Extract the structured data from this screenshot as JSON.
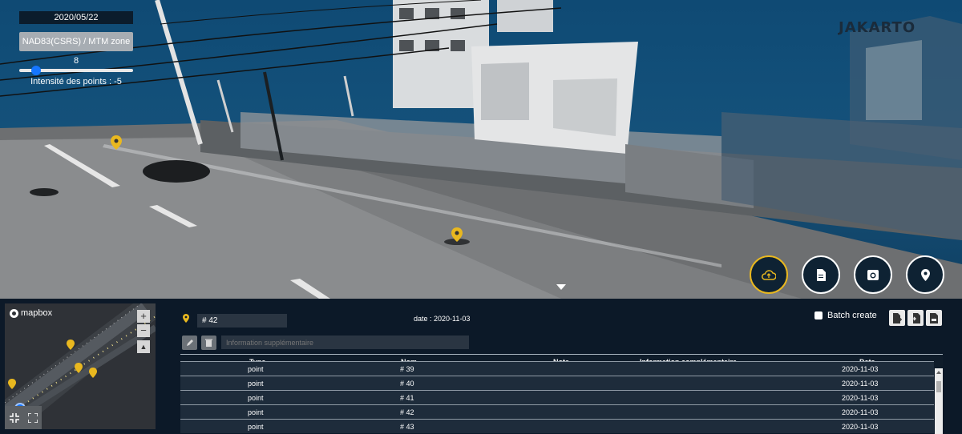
{
  "viewer": {
    "date": "2020/05/22",
    "crs_label": "NAD83(CSRS) / MTM zone 8",
    "intensity_label": "Intensité des points : -5",
    "intensity_value": -5,
    "brand": "JAKARTO"
  },
  "tools": [
    {
      "name": "cloud-upload-icon",
      "active": true
    },
    {
      "name": "document-icon",
      "active": false
    },
    {
      "name": "camera-icon",
      "active": false
    },
    {
      "name": "location-pin-icon",
      "active": false
    }
  ],
  "minimap": {
    "logo": "mapbox",
    "zoom_in": "+",
    "zoom_out": "−"
  },
  "form": {
    "name_value": "# 42",
    "date_text": "date : 2020-11-03",
    "info_placeholder": "Information supplémentaire",
    "batch_label": "Batch create"
  },
  "table": {
    "headers": [
      "Type",
      "Nom",
      "Note",
      "Information complémentaire",
      "Date"
    ],
    "rows": [
      {
        "type": "point",
        "nom": "# 39",
        "note": "",
        "info": "",
        "date": "2020-11-03"
      },
      {
        "type": "point",
        "nom": "# 40",
        "note": "",
        "info": "",
        "date": "2020-11-03"
      },
      {
        "type": "point",
        "nom": "# 41",
        "note": "",
        "info": "",
        "date": "2020-11-03"
      },
      {
        "type": "point",
        "nom": "# 42",
        "note": "",
        "info": "",
        "date": "2020-11-03"
      },
      {
        "type": "point",
        "nom": "# 43",
        "note": "",
        "info": "",
        "date": "2020-11-03"
      }
    ]
  },
  "colors": {
    "accent": "#e9b81f",
    "sky": "#124f79",
    "panel": "#0c1928",
    "slider_thumb": "#1576ff"
  }
}
